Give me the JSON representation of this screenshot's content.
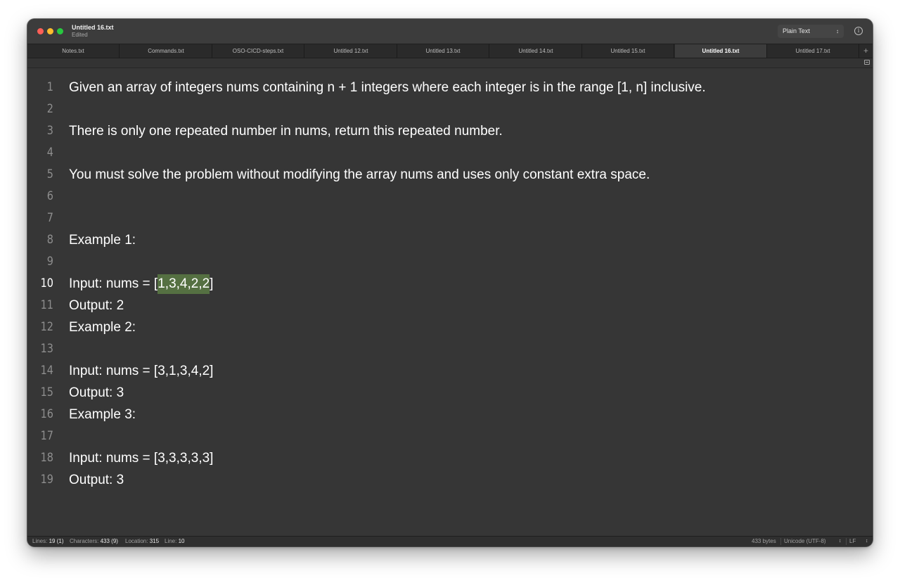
{
  "window": {
    "title": "Untitled 16.txt",
    "subtitle": "Edited",
    "syntax_mode": "Plain Text",
    "info_glyph": "i"
  },
  "tabs": [
    {
      "label": "Notes.txt",
      "active": false
    },
    {
      "label": "Commands.txt",
      "active": false
    },
    {
      "label": "OSO-CICD-steps.txt",
      "active": false
    },
    {
      "label": "Untitled 12.txt",
      "active": false
    },
    {
      "label": "Untitled 13.txt",
      "active": false
    },
    {
      "label": "Untitled 14.txt",
      "active": false
    },
    {
      "label": "Untitled 15.txt",
      "active": false
    },
    {
      "label": "Untitled 16.txt",
      "active": true
    },
    {
      "label": "Untitled 17.txt",
      "active": false
    }
  ],
  "tab_add_glyph": "+",
  "editor": {
    "current_line": 10,
    "lines": [
      {
        "num": "1",
        "text": "Given an array of integers nums containing n + 1 integers where each integer is in the range [1, n] inclusive."
      },
      {
        "num": "2",
        "text": ""
      },
      {
        "num": "3",
        "text": "There is only one repeated number in nums, return this repeated number."
      },
      {
        "num": "4",
        "text": ""
      },
      {
        "num": "5",
        "text": "You must solve the problem without modifying the array nums and uses only constant extra space."
      },
      {
        "num": "6",
        "text": ""
      },
      {
        "num": "7",
        "text": ""
      },
      {
        "num": "8",
        "text": "Example 1:"
      },
      {
        "num": "9",
        "text": ""
      },
      {
        "num": "10",
        "text": "Input: nums = [1,3,4,2,2]",
        "sel_before": "Input: nums = [",
        "sel_text": "1,3,4,2,2",
        "sel_after": "]"
      },
      {
        "num": "11",
        "text": "Output: 2"
      },
      {
        "num": "12",
        "text": "Example 2:"
      },
      {
        "num": "13",
        "text": ""
      },
      {
        "num": "14",
        "text": "Input: nums = [3,1,3,4,2]"
      },
      {
        "num": "15",
        "text": "Output: 3"
      },
      {
        "num": "16",
        "text": "Example 3:"
      },
      {
        "num": "17",
        "text": ""
      },
      {
        "num": "18",
        "text": "Input: nums = [3,3,3,3,3]"
      },
      {
        "num": "19",
        "text": "Output: 3"
      }
    ]
  },
  "status": {
    "lines_label": "Lines:",
    "lines_value": "19 (1)",
    "chars_label": "Characters:",
    "chars_value": "433 (9)",
    "location_label": "Location:",
    "location_value": "315",
    "line_label": "Line:",
    "line_value": "10",
    "file_size": "433 bytes",
    "encoding": "Unicode (UTF-8)",
    "line_endings": "LF"
  },
  "colors": {
    "selection": "#557042",
    "editor_bg": "#363636",
    "close": "#ff5f57",
    "minimize": "#febc2e",
    "maximize": "#28c840"
  }
}
